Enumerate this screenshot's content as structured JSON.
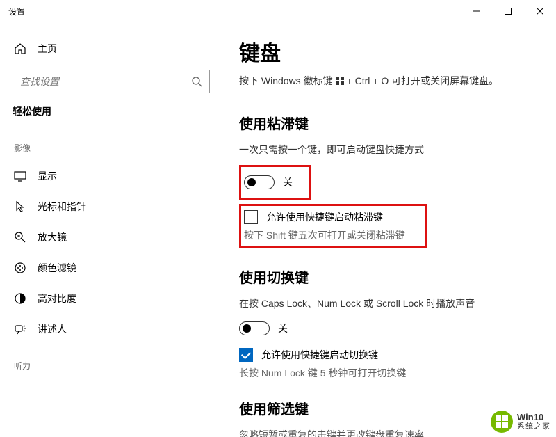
{
  "window": {
    "title": "设置"
  },
  "sidebar": {
    "home": "主页",
    "search_placeholder": "查找设置",
    "section_header": "轻松使用",
    "cat_vision": "影像",
    "cat_hearing": "听力",
    "items": [
      {
        "label": "显示"
      },
      {
        "label": "光标和指针"
      },
      {
        "label": "放大镜"
      },
      {
        "label": "颜色滤镜"
      },
      {
        "label": "高对比度"
      },
      {
        "label": "讲述人"
      }
    ]
  },
  "main": {
    "title": "键盘",
    "subnote_before": "按下 Windows 徽标键",
    "subnote_after": "+ Ctrl + O 可打开或关闭屏幕键盘。",
    "sticky": {
      "title": "使用粘滞键",
      "desc": "一次只需按一个键，即可启动键盘快捷方式",
      "toggle_state": "关",
      "check_label": "允许使用快捷键启动粘滞键",
      "hint": "按下 Shift 键五次可打开或关闭粘滞键"
    },
    "toggle_keys": {
      "title": "使用切换键",
      "desc": "在按 Caps Lock、Num Lock 或 Scroll Lock 时播放声音",
      "toggle_state": "关",
      "check_label": "允许使用快捷键启动切换键",
      "hint": "长按 Num Lock 键 5 秒钟可打开切换键"
    },
    "filter": {
      "title": "使用筛选键",
      "desc": "忽略短暂或重复的击键并更改键盘重复速率"
    }
  },
  "watermark": {
    "line1": "Win10",
    "line2": "系统之家"
  }
}
